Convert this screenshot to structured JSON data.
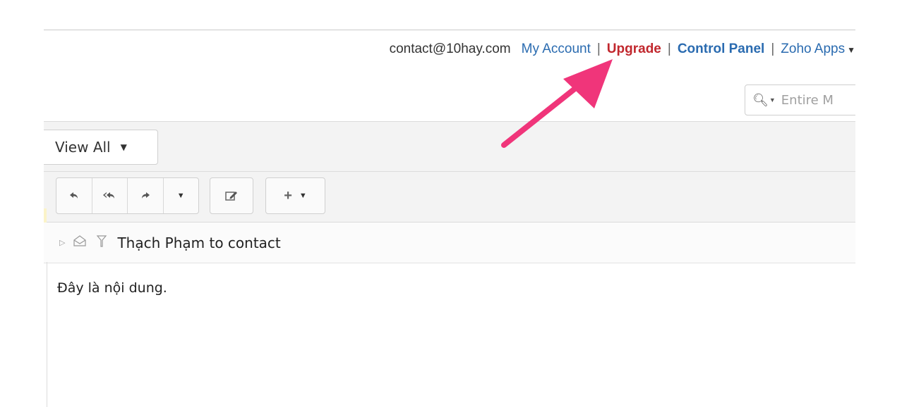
{
  "header": {
    "email": "contact@10hay.com",
    "my_account": "My Account",
    "upgrade": "Upgrade",
    "control_panel": "Control Panel",
    "zoho_apps": "Zoho Apps",
    "separator": "|"
  },
  "search": {
    "placeholder": "Entire M"
  },
  "toolbar": {
    "view_all": "View All"
  },
  "message": {
    "summary": "Thạch Phạm to contact",
    "body": "Đây là nội dung."
  },
  "colors": {
    "link": "#2a6bb0",
    "upgrade": "#c1272d",
    "arrow": "#f0357a"
  }
}
